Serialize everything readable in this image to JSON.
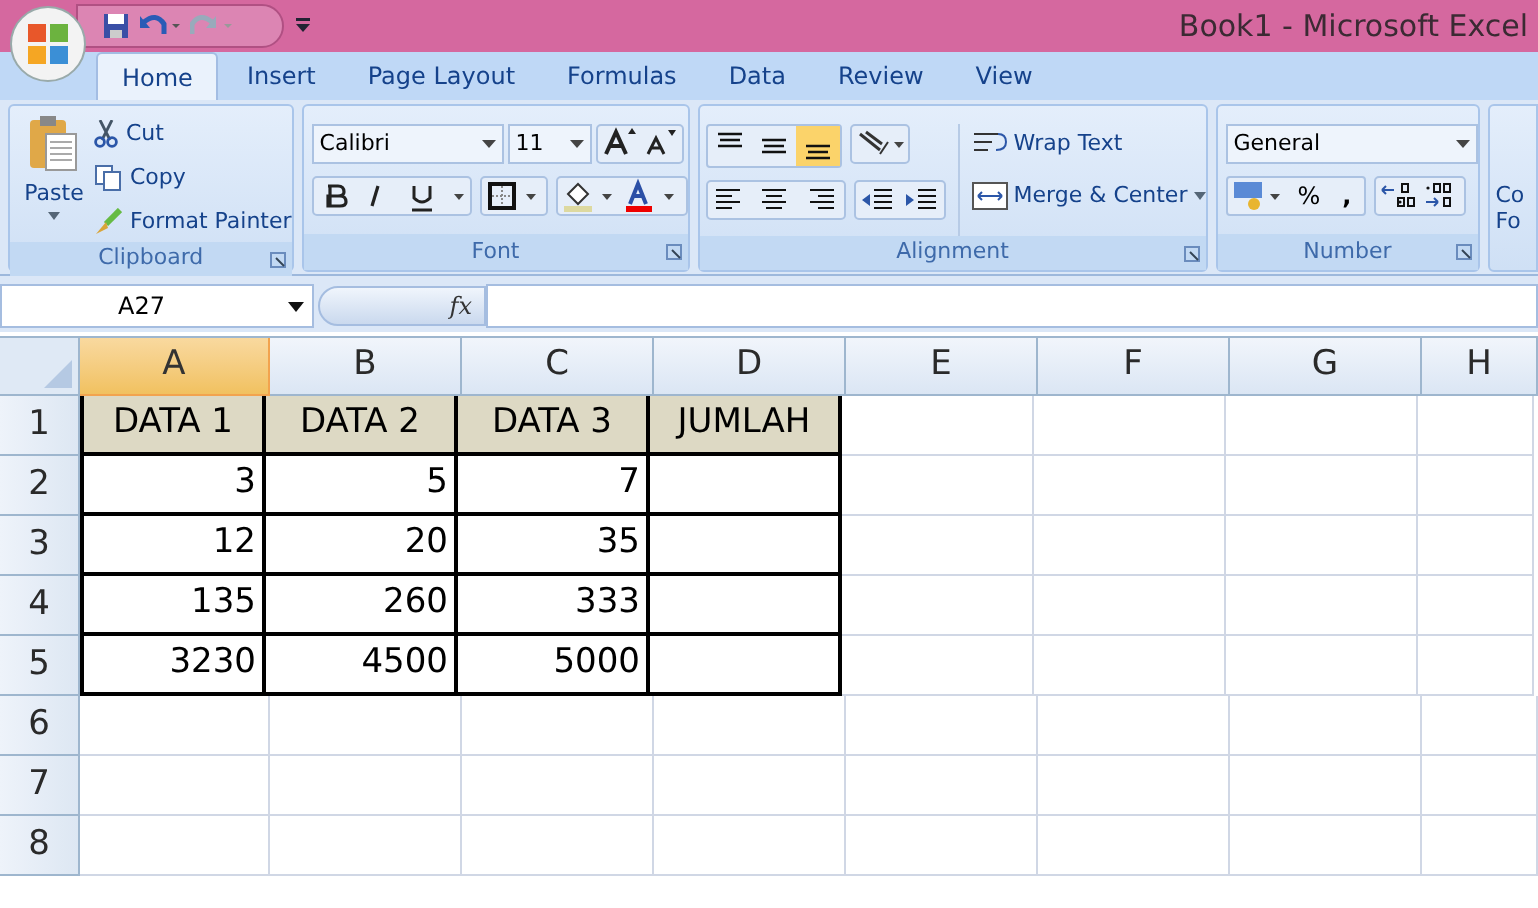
{
  "window": {
    "title": "Book1 - Microsoft Excel"
  },
  "tabs": [
    {
      "label": "Home",
      "selected": true
    },
    {
      "label": "Insert",
      "selected": false
    },
    {
      "label": "Page Layout",
      "selected": false
    },
    {
      "label": "Formulas",
      "selected": false
    },
    {
      "label": "Data",
      "selected": false
    },
    {
      "label": "Review",
      "selected": false
    },
    {
      "label": "View",
      "selected": false
    }
  ],
  "ribbon": {
    "clipboard": {
      "label": "Clipboard",
      "paste": "Paste",
      "cut": "Cut",
      "copy": "Copy",
      "format_painter": "Format Painter"
    },
    "font": {
      "label": "Font",
      "font_name": "Calibri",
      "font_size": "11"
    },
    "alignment": {
      "label": "Alignment",
      "vertical_align": [
        {
          "kind": "top",
          "selected": false
        },
        {
          "kind": "middle",
          "selected": false
        },
        {
          "kind": "bottom",
          "selected": true
        }
      ],
      "wrap_text": "Wrap Text",
      "merge_center": "Merge & Center"
    },
    "number": {
      "label": "Number",
      "format": "General",
      "percent": "%",
      "comma": ","
    },
    "next_group": {
      "line_1": "Co",
      "line_2": "Fo"
    }
  },
  "formula_bar": {
    "name_box": "A27",
    "fx": "fx"
  },
  "sheet": {
    "columns": [
      {
        "label": "A",
        "selected": true
      },
      {
        "label": "B",
        "selected": false
      },
      {
        "label": "C",
        "selected": false
      },
      {
        "label": "D",
        "selected": false
      },
      {
        "label": "E",
        "selected": false
      },
      {
        "label": "F",
        "selected": false
      },
      {
        "label": "G",
        "selected": false
      },
      {
        "label": "H",
        "selected": false
      }
    ],
    "rows": [
      {
        "label": "1",
        "cells": [
          {
            "kind": "header",
            "value": "DATA 1"
          },
          {
            "kind": "header",
            "value": "DATA 2"
          },
          {
            "kind": "header",
            "value": "DATA 3"
          },
          {
            "kind": "header",
            "value": "JUMLAH"
          }
        ]
      },
      {
        "label": "2",
        "cells": [
          {
            "kind": "number",
            "value": "3"
          },
          {
            "kind": "number",
            "value": "5"
          },
          {
            "kind": "number",
            "value": "7"
          },
          {
            "kind": "number"
          }
        ]
      },
      {
        "label": "3",
        "cells": [
          {
            "kind": "number",
            "value": "12"
          },
          {
            "kind": "number",
            "value": "20"
          },
          {
            "kind": "number",
            "value": "35"
          },
          {
            "kind": "number"
          }
        ]
      },
      {
        "label": "4",
        "cells": [
          {
            "kind": "number",
            "value": "135"
          },
          {
            "kind": "number",
            "value": "260"
          },
          {
            "kind": "number",
            "value": "333"
          },
          {
            "kind": "number"
          }
        ]
      },
      {
        "label": "5",
        "cells": [
          {
            "kind": "number",
            "value": "3230"
          },
          {
            "kind": "number",
            "value": "4500"
          },
          {
            "kind": "number",
            "value": "5000"
          },
          {
            "kind": "number"
          }
        ]
      },
      {
        "label": "6",
        "cells": []
      },
      {
        "label": "7",
        "cells": []
      },
      {
        "label": "8",
        "cells": []
      }
    ]
  }
}
